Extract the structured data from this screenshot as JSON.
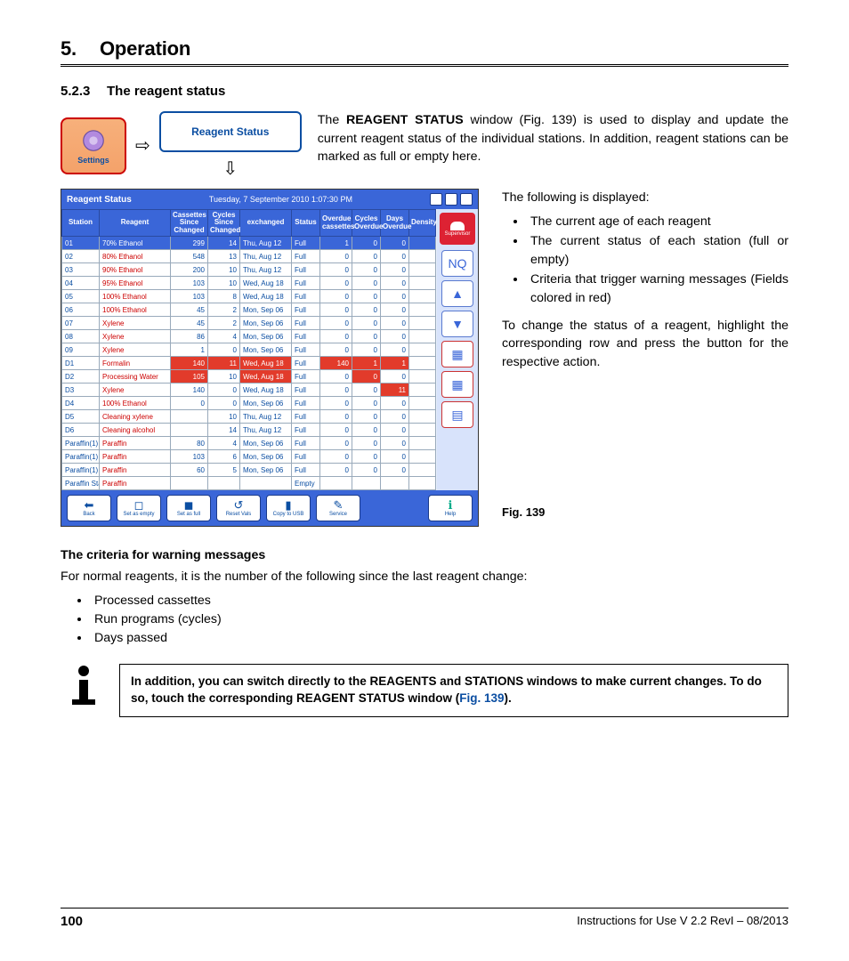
{
  "chapter": {
    "num": "5.",
    "title": "Operation"
  },
  "subsection": {
    "num": "5.2.3",
    "title": "The reagent status"
  },
  "nav": {
    "settings_label": "Settings",
    "reagent_btn": "Reagent Status",
    "arrow_right": "⇨",
    "arrow_down": "⇩"
  },
  "para1_pre": "The ",
  "para1_bold": "REAGENT STATUS",
  "para1_post": " window (Fig. 139) is used to display and update the current reagent status of the individual stations. In addition, reagent stations can be marked as full or empty here.",
  "screenshot": {
    "title": "Reagent Status",
    "datetime": "Tuesday, 7 September 2010 1:07:30 PM",
    "supervisor": "Supervisor",
    "headers": [
      "Station",
      "Reagent",
      "Cassettes Since Changed",
      "Cycles Since Changed",
      "exchanged",
      "Status",
      "Overdue cassettes",
      "Cycles Overdue",
      "Days Overdue",
      "Density"
    ],
    "rows": [
      {
        "sel": true,
        "cells": [
          "01",
          "70% Ethanol",
          "299",
          "14",
          "Thu, Aug 12",
          "Full",
          "1",
          "0",
          "0",
          ""
        ]
      },
      {
        "cells": [
          "02",
          "80% Ethanol",
          "548",
          "13",
          "Thu, Aug 12",
          "Full",
          "0",
          "0",
          "0",
          ""
        ]
      },
      {
        "cells": [
          "03",
          "90% Ethanol",
          "200",
          "10",
          "Thu, Aug 12",
          "Full",
          "0",
          "0",
          "0",
          ""
        ]
      },
      {
        "cells": [
          "04",
          "95% Ethanol",
          "103",
          "10",
          "Wed, Aug 18",
          "Full",
          "0",
          "0",
          "0",
          ""
        ]
      },
      {
        "cells": [
          "05",
          "100% Ethanol",
          "103",
          "8",
          "Wed, Aug 18",
          "Full",
          "0",
          "0",
          "0",
          ""
        ]
      },
      {
        "cells": [
          "06",
          "100% Ethanol",
          "45",
          "2",
          "Mon, Sep 06",
          "Full",
          "0",
          "0",
          "0",
          ""
        ]
      },
      {
        "cells": [
          "07",
          "Xylene",
          "45",
          "2",
          "Mon, Sep 06",
          "Full",
          "0",
          "0",
          "0",
          ""
        ]
      },
      {
        "cells": [
          "08",
          "Xylene",
          "86",
          "4",
          "Mon, Sep 06",
          "Full",
          "0",
          "0",
          "0",
          ""
        ]
      },
      {
        "cells": [
          "09",
          "Xylene",
          "1",
          "0",
          "Mon, Sep 06",
          "Full",
          "0",
          "0",
          "0",
          ""
        ]
      },
      {
        "red": [
          2,
          3,
          4,
          6,
          7,
          8
        ],
        "cells": [
          "D1",
          "Formalin",
          "140",
          "11",
          "Wed, Aug 18",
          "Full",
          "140",
          "1",
          "1",
          ""
        ]
      },
      {
        "red": [
          2,
          4,
          7
        ],
        "cells": [
          "D2",
          "Processing Water",
          "105",
          "10",
          "Wed, Aug 18",
          "Full",
          "0",
          "0",
          "0",
          ""
        ]
      },
      {
        "red": [
          8
        ],
        "cells": [
          "D3",
          "Xylene",
          "140",
          "0",
          "Wed, Aug 18",
          "Full",
          "0",
          "0",
          "11",
          ""
        ]
      },
      {
        "cells": [
          "D4",
          "100% Ethanol",
          "0",
          "0",
          "Mon, Sep 06",
          "Full",
          "0",
          "0",
          "0",
          ""
        ]
      },
      {
        "cells": [
          "D5",
          "Cleaning xylene",
          "",
          "10",
          "Thu, Aug 12",
          "Full",
          "0",
          "0",
          "0",
          ""
        ]
      },
      {
        "cells": [
          "D6",
          "Cleaning alcohol",
          "",
          "14",
          "Thu, Aug 12",
          "Full",
          "0",
          "0",
          "0",
          ""
        ]
      },
      {
        "cells": [
          "Paraffin(1)",
          "Paraffin",
          "80",
          "4",
          "Mon, Sep 06",
          "Full",
          "0",
          "0",
          "0",
          ""
        ]
      },
      {
        "cells": [
          "Paraffin(1)",
          "Paraffin",
          "103",
          "6",
          "Mon, Sep 06",
          "Full",
          "0",
          "0",
          "0",
          ""
        ]
      },
      {
        "cells": [
          "Paraffin(1)",
          "Paraffin",
          "60",
          "5",
          "Mon, Sep 06",
          "Full",
          "0",
          "0",
          "0",
          ""
        ]
      },
      {
        "cells": [
          "Paraffin Station",
          "Paraffin",
          "",
          "",
          "",
          "Empty",
          "",
          "",
          "",
          ""
        ]
      }
    ],
    "side": {
      "nq": "NQ"
    },
    "bottom": {
      "back": "Back",
      "set_empty": "Set as empty",
      "set_full": "Set as full",
      "reset": "Reset Vals",
      "copy": "Copy to USB",
      "service": "Service",
      "help": "Help"
    }
  },
  "right": {
    "intro": "The following is displayed:",
    "li1": "The current age of each reagent",
    "li2": "The current status of each station (full or empty)",
    "li3": "Criteria that trigger warning messages (Fields colored in red)",
    "para2": "To change the status of a reagent, highlight the corresponding row and press the button for the respective action.",
    "fig": "Fig. 139"
  },
  "criteria": {
    "h": "The criteria for warning messages",
    "intro": "For normal reagents, it is the number of the following since the last reagent change:",
    "li1": "Processed cassettes",
    "li2": "Run programs (cycles)",
    "li3": "Days passed"
  },
  "note": {
    "t1": "In addition, you can switch directly to the REAGENTS and STATIONS windows to make current changes. To do so, touch the corresponding REAGENT STATUS window (",
    "link": "Fig. 139",
    "t2": ")."
  },
  "footer": {
    "page": "100",
    "doc": "Instructions for Use V 2.2 RevI – 08/2013"
  }
}
